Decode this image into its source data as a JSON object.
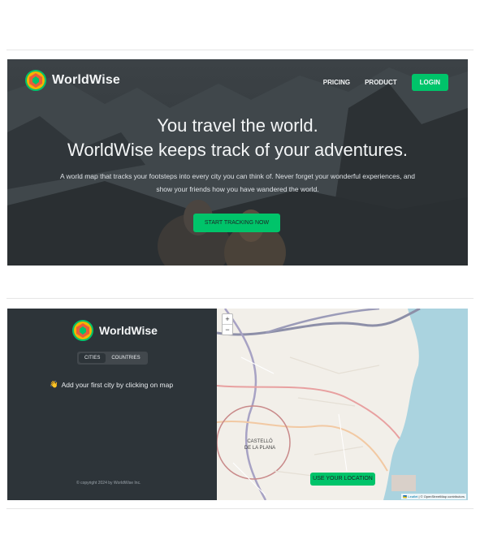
{
  "hero": {
    "brand": "WorldWise",
    "nav": {
      "pricing": "PRICING",
      "product": "PRODUCT",
      "login": "LOGIN"
    },
    "headline_1": "You travel the world.",
    "headline_2": "WorldWise keeps track of your adventures.",
    "description": "A world map that tracks your footsteps into every city you can think of. Never forget your wonderful experiences, and show your friends how you have wandered the world.",
    "cta": "START TRACKING NOW"
  },
  "app": {
    "brand": "WorldWise",
    "tabs": {
      "cities": "CITIES",
      "countries": "COUNTRIES"
    },
    "empty_icon": "👋",
    "empty_message": "Add your first city by clicking on map",
    "copyright": "© copyright 2024 by WorldWise Inc."
  },
  "map": {
    "zoom_in": "+",
    "zoom_out": "−",
    "city_label_1": "CASTELLÓ",
    "city_label_2": "DE LA PLANA",
    "use_location": "USE YOUR LOCATION",
    "attribution_leaflet": "🇺🇦 Leaflet",
    "attribution_rest": "| © OpenStreetMap contributors"
  },
  "colors": {
    "brand_green": "#00c46a",
    "dark_bg": "#2d3439",
    "sea": "#aad3df"
  }
}
